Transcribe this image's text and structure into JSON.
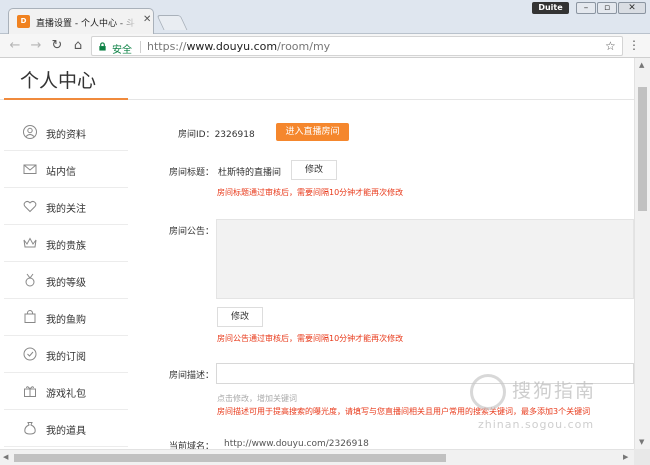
{
  "browser": {
    "tab_title": "直播设置 - 个人中心 - 斗",
    "tab_favicon_text": "D",
    "extension_badge": "Duite",
    "address": {
      "security_label": "安全",
      "protocol": "https://",
      "host": "www.douyu.com",
      "path": "/room/my"
    },
    "icons": {
      "back": "back-arrow-icon",
      "forward": "forward-arrow-icon",
      "reload": "reload-icon",
      "home": "home-icon",
      "lock": "lock-icon",
      "bookmark": "star-icon",
      "menu": "kebab-menu-icon"
    }
  },
  "page": {
    "title": "个人中心"
  },
  "sidebar": {
    "items": [
      {
        "label": "我的资料",
        "icon": "user-icon"
      },
      {
        "label": "站内信",
        "icon": "mail-icon"
      },
      {
        "label": "我的关注",
        "icon": "heart-icon"
      },
      {
        "label": "我的贵族",
        "icon": "crown-icon"
      },
      {
        "label": "我的等级",
        "icon": "medal-icon"
      },
      {
        "label": "我的鱼购",
        "icon": "shopping-bag-icon"
      },
      {
        "label": "我的订阅",
        "icon": "subscribe-icon"
      },
      {
        "label": "游戏礼包",
        "icon": "gift-icon"
      },
      {
        "label": "我的道具",
        "icon": "money-bag-icon"
      }
    ]
  },
  "room": {
    "id_label": "房间ID：2326918",
    "enter_button": "进入直播房间",
    "title_label": "房间标题：",
    "title_value": "杜斯特的直播间",
    "edit_button": "修改",
    "title_warning": "房间标题通过审核后，需要间隔10分钟才能再次修改",
    "notice_label": "房间公告：",
    "notice_edit_button": "修改",
    "notice_warning": "房间公告通过审核后，需要间隔10分钟才能再次修改",
    "desc_label": "房间描述：",
    "desc_hint": "点击修改，增加关键词",
    "desc_warning": "房间描述可用于提高搜索的曝光度，请填写与您直播间相关且用户常用的搜索关键词，最多添加3个关键词",
    "domain_label": "当前域名：",
    "domain_value": "http://www.douyu.com/2326918"
  },
  "watermark": {
    "brand_text": "搜狗指南",
    "url_text": "zhinan.sogou.com"
  },
  "colors": {
    "accent": "#f5872d",
    "warning": "#e8391a",
    "secure": "#0b8043"
  }
}
